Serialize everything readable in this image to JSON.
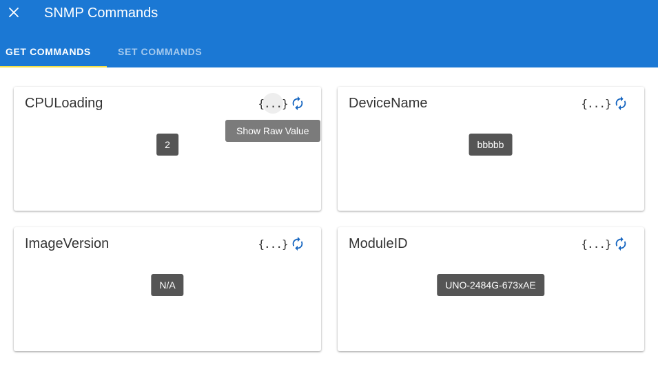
{
  "header": {
    "title": "SNMP Commands",
    "background": "#1b78d4"
  },
  "tabs": [
    {
      "label": "GET COMMANDS",
      "active": true
    },
    {
      "label": "SET COMMANDS",
      "active": false
    }
  ],
  "cards": [
    {
      "title": "CPULoading",
      "value": "2",
      "raw_icon": "{...}"
    },
    {
      "title": "DeviceName",
      "value": "bbbbb",
      "raw_icon": "{...}"
    },
    {
      "title": "ImageVersion",
      "value": "N/A",
      "raw_icon": "{...}"
    },
    {
      "title": "ModuleID",
      "value": "UNO-2484G-673xAE",
      "raw_icon": "{...}"
    }
  ],
  "tooltip": {
    "text": "Show Raw Value"
  },
  "colors": {
    "accent": "#1b78d4",
    "tab_indicator": "#f5e046",
    "refresh_icon": "#1565c0",
    "chip": "#555555",
    "tooltip": "#7b7b7b"
  },
  "icons": {
    "close": "close-icon",
    "raw": "code-braces-icon",
    "refresh": "refresh-icon"
  }
}
